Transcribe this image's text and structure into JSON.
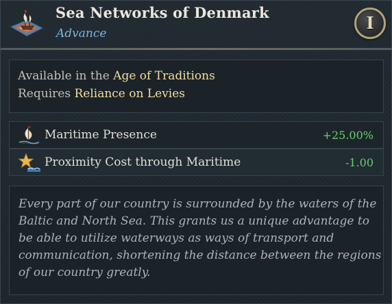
{
  "header": {
    "title": "Sea Networks of Denmark",
    "subtitle": "Advance",
    "age_numeral": "I",
    "icon": "ship-on-map-icon"
  },
  "requirements": {
    "line1_prefix": "Available in the",
    "line1_value": "Age of Traditions",
    "line2_prefix": "Requires",
    "line2_value": "Reliance on Levies"
  },
  "modifiers": [
    {
      "icon": "sailing-ship-icon",
      "label": "Maritime Presence",
      "value": "+25.00%"
    },
    {
      "icon": "star-wave-icon",
      "label": "Proximity Cost through Maritime",
      "value": "-1.00"
    }
  ],
  "description": "Every part of our country is surrounded by the waters of the Baltic and North Sea. This grants us a unique advantage to be able to utilize waterways as ways of transport and communication, shortening the distance between the regions of our country greatly.",
  "colors": {
    "title": "#e9e7de",
    "subtitle": "#7fb4db",
    "highlight": "#f2dfa0",
    "positive": "#67d16a",
    "description": "#aeb3b2"
  }
}
